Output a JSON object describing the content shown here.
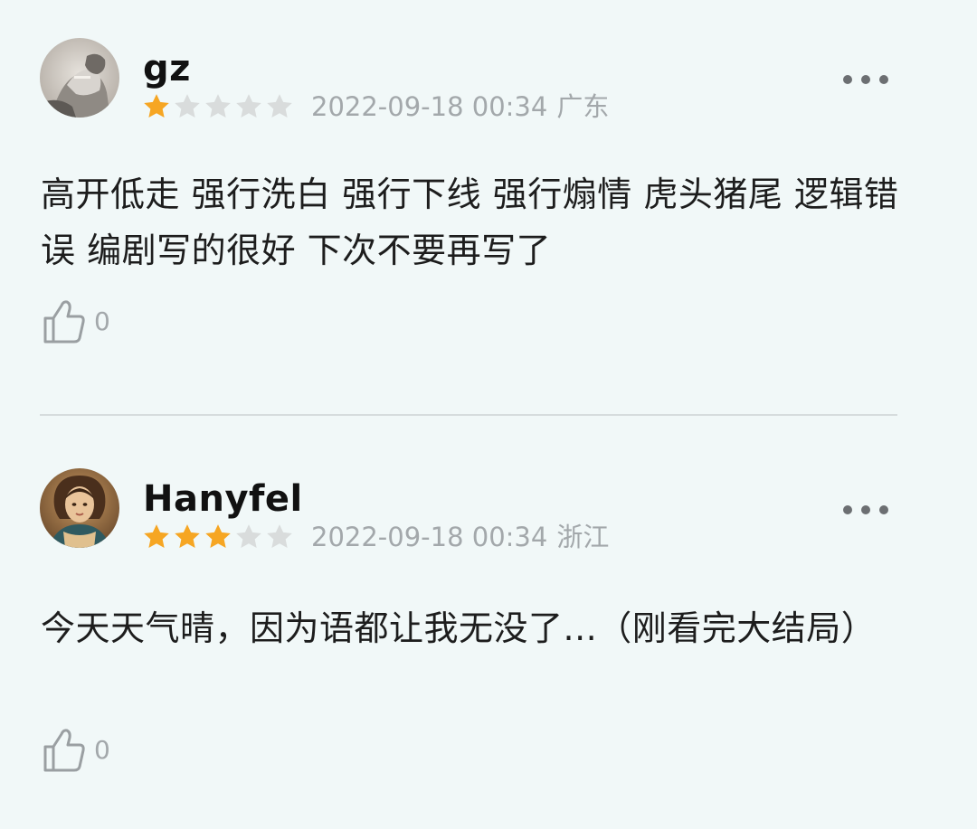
{
  "comments": [
    {
      "username": "gz",
      "rating": 1,
      "rating_max": 5,
      "timestamp": "2022-09-18 00:34",
      "location": "广东",
      "text": "高开低走 强行洗白 强行下线 强行煽情 虎头猪尾 逻辑错误 编剧写的很好 下次不要再写了",
      "likes": "0",
      "avatar_icon": "avatar-photo-bw"
    },
    {
      "username": "Hanyfel",
      "rating": 3,
      "rating_max": 5,
      "timestamp": "2022-09-18 00:34",
      "location": "浙江",
      "text": "今天天气晴，因为语都让我无没了...（刚看完大结局）",
      "likes": "0",
      "avatar_icon": "avatar-painting"
    }
  ],
  "colors": {
    "background": "#f1f8f8",
    "star_filled": "#f6a623",
    "star_empty": "#d9dcdc",
    "meta_text": "#a3a8ab",
    "divider": "#d6dcdd"
  },
  "icons": {
    "more": "more-dots-icon",
    "like": "thumbs-up-icon",
    "star": "star-icon"
  }
}
